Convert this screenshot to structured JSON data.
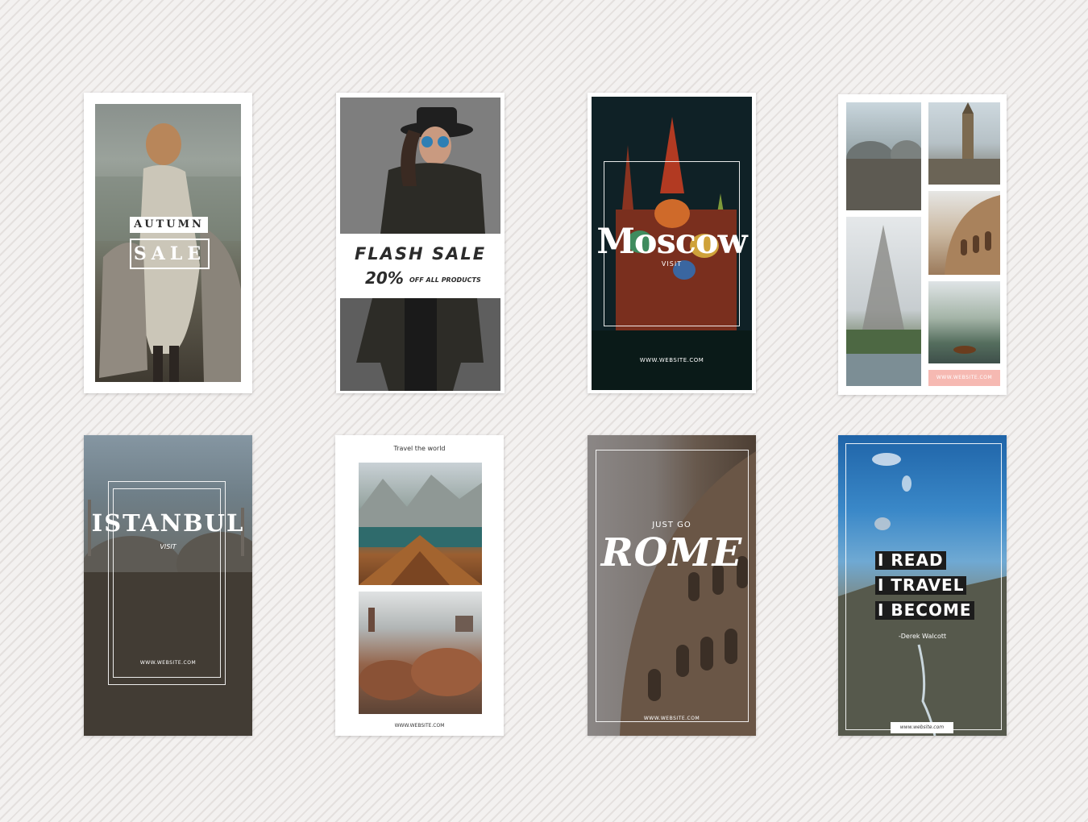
{
  "cards": [
    {
      "id": "autumn-sale",
      "line1": "AUTUMN",
      "line2": "SALE"
    },
    {
      "id": "flash-sale",
      "title": "FLASH SALE",
      "percent": "20%",
      "subtitle": "OFF ALL PRODUCTS"
    },
    {
      "id": "moscow",
      "title": "Moscow",
      "kicker": "VISIT",
      "website": "WWW.WEBSITE.COM"
    },
    {
      "id": "collage",
      "website": "WWW.WEBSITE.COM"
    },
    {
      "id": "istanbul",
      "title": "ISTANBUL",
      "kicker": "VISIT",
      "website": "WWW.WEBSITE.COM"
    },
    {
      "id": "travel-world",
      "heading": "Travel the world",
      "website": "WWW.WEBSITE.COM"
    },
    {
      "id": "rome",
      "kicker": "JUST GO",
      "title": "ROME",
      "website": "WWW.WEBSITE.COM"
    },
    {
      "id": "quote",
      "lines": [
        "I READ",
        "I TRAVEL",
        "I BECOME"
      ],
      "author": "-Derek Walcott",
      "website": "www.website.com"
    }
  ],
  "colors": {
    "background": "#efeceb",
    "card_background": "#ffffff",
    "text_dark": "#2b2b2b",
    "collage_badge": "#f6b9b2",
    "quote_bar": "#1c1c1c"
  }
}
